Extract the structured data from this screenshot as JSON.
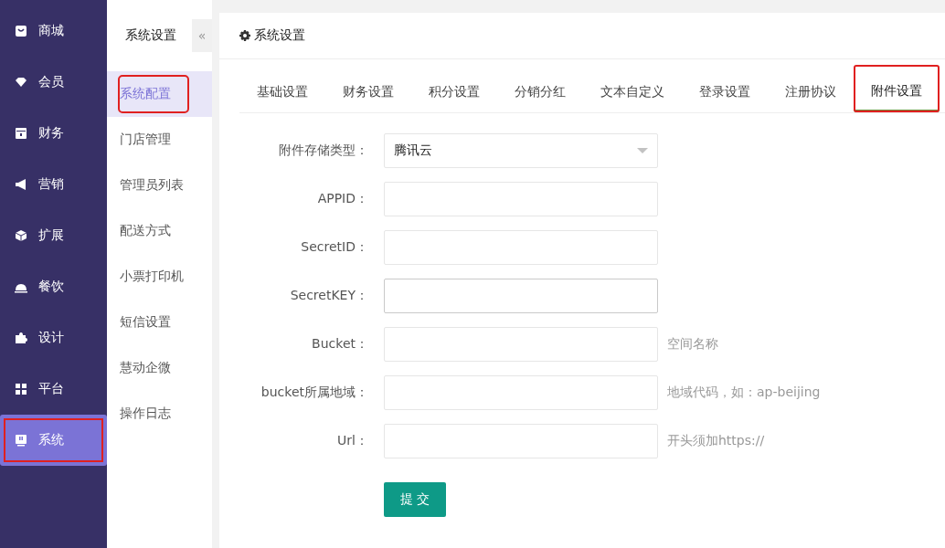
{
  "sidebar": {
    "items": [
      {
        "label": "商城",
        "selected": false,
        "marked": false
      },
      {
        "label": "会员",
        "selected": false,
        "marked": false
      },
      {
        "label": "财务",
        "selected": false,
        "marked": false
      },
      {
        "label": "营销",
        "selected": false,
        "marked": false
      },
      {
        "label": "扩展",
        "selected": false,
        "marked": false
      },
      {
        "label": "餐饮",
        "selected": false,
        "marked": false
      },
      {
        "label": "设计",
        "selected": false,
        "marked": false
      },
      {
        "label": "平台",
        "selected": false,
        "marked": false
      },
      {
        "label": "系统",
        "selected": true,
        "marked": true
      }
    ]
  },
  "submenu": {
    "title": "系统设置",
    "collapse": "«",
    "items": [
      {
        "label": "系统配置",
        "selected": true,
        "marked": true
      },
      {
        "label": "门店管理",
        "selected": false,
        "marked": false
      },
      {
        "label": "管理员列表",
        "selected": false,
        "marked": false
      },
      {
        "label": "配送方式",
        "selected": false,
        "marked": false
      },
      {
        "label": "小票打印机",
        "selected": false,
        "marked": false
      },
      {
        "label": "短信设置",
        "selected": false,
        "marked": false
      },
      {
        "label": "慧动企微",
        "selected": false,
        "marked": false
      },
      {
        "label": "操作日志",
        "selected": false,
        "marked": false
      }
    ]
  },
  "panel": {
    "title": "系统设置",
    "tabs": [
      {
        "label": "基础设置",
        "selected": false,
        "marked": false
      },
      {
        "label": "财务设置",
        "selected": false,
        "marked": false
      },
      {
        "label": "积分设置",
        "selected": false,
        "marked": false
      },
      {
        "label": "分销分红",
        "selected": false,
        "marked": false
      },
      {
        "label": "文本自定义",
        "selected": false,
        "marked": false
      },
      {
        "label": "登录设置",
        "selected": false,
        "marked": false
      },
      {
        "label": "注册协议",
        "selected": false,
        "marked": false
      },
      {
        "label": "附件设置",
        "selected": true,
        "marked": true
      }
    ],
    "fields": [
      {
        "kind": "select",
        "label": "附件存储类型：",
        "value": "腾讯云",
        "focused": false
      },
      {
        "kind": "input",
        "label": "APPID：",
        "focused": false
      },
      {
        "kind": "input",
        "label": "SecretID：",
        "focused": false
      },
      {
        "kind": "input",
        "label": "SecretKEY：",
        "focused": true
      },
      {
        "kind": "input",
        "label": "Bucket：",
        "hint": "空间名称",
        "focused": false
      },
      {
        "kind": "input",
        "label": "bucket所属地域：",
        "hint": "地域代码，如：ap-beijing",
        "focused": false
      },
      {
        "kind": "input",
        "label": "Url：",
        "hint": "开头须加https://",
        "focused": false
      }
    ],
    "submit": "提 交"
  }
}
